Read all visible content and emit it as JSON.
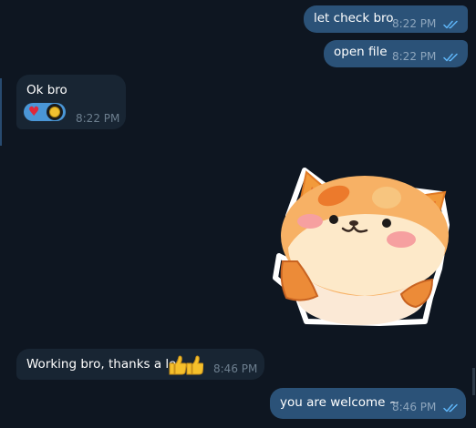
{
  "messages": [
    {
      "id": "m1",
      "direction": "outgoing",
      "text": "let check bro",
      "time": "8:22 PM",
      "status": "read"
    },
    {
      "id": "m2",
      "direction": "outgoing",
      "text": "open file",
      "time": "8:22 PM",
      "status": "read"
    },
    {
      "id": "m3",
      "direction": "incoming",
      "text": "Ok bro",
      "time": "8:22 PM",
      "reactions": [
        "red-heart"
      ]
    },
    {
      "id": "m4",
      "direction": "incoming",
      "text": "Working bro, thanks a lot",
      "emoji": [
        "thumbs-up",
        "thumbs-up"
      ],
      "time": "8:46 PM"
    },
    {
      "id": "m5",
      "direction": "outgoing",
      "text": "you are welcome ~",
      "time": "8:46 PM",
      "status": "read"
    }
  ],
  "sticker": {
    "icon": "orange-cat-sticker"
  },
  "colors": {
    "background": "#0e1621",
    "outgoing_bubble": "#2b5278",
    "incoming_bubble": "#182533",
    "read_ticks": "#5eb5f7"
  }
}
